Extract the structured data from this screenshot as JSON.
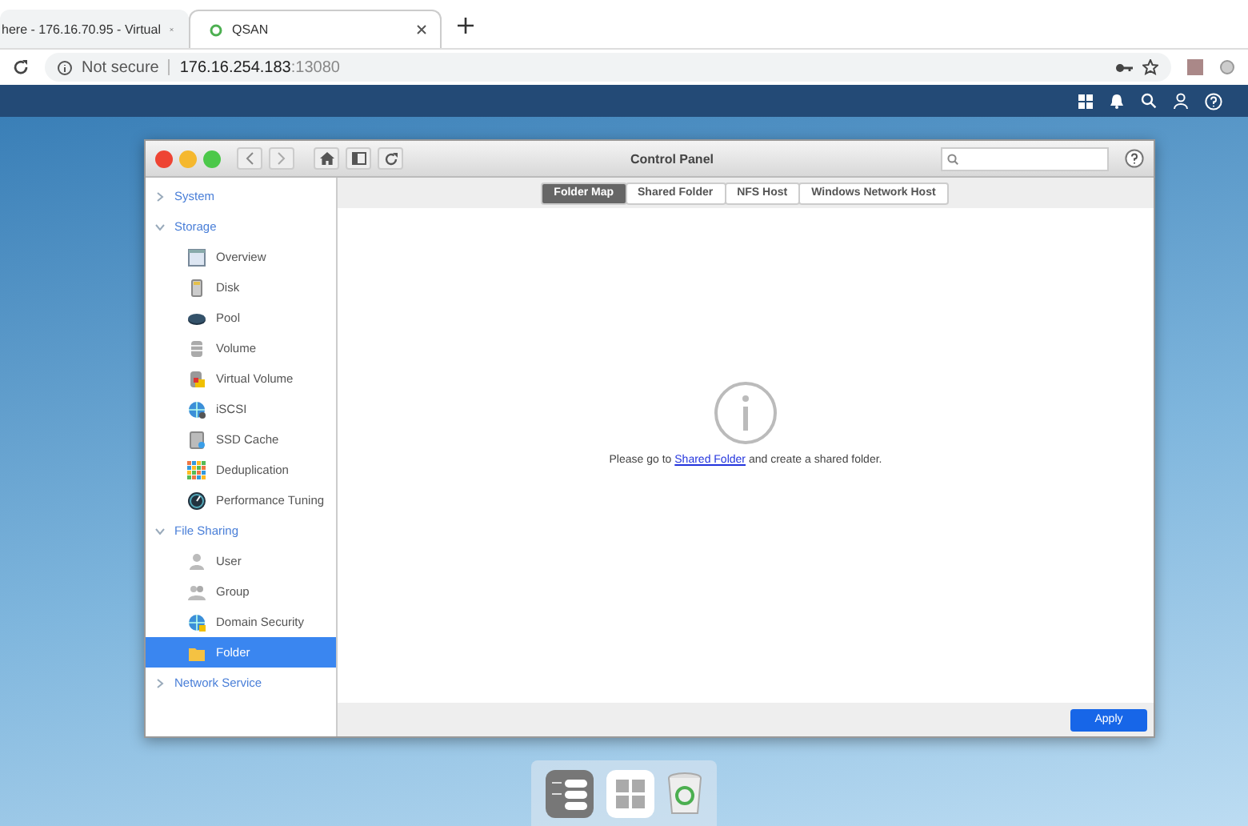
{
  "browser": {
    "tabs": [
      {
        "title": "here - 176.16.70.95 - Virtual",
        "selected": false
      },
      {
        "title": "QSAN",
        "selected": true
      }
    ],
    "security": "Not secure",
    "url_host": "176.16.254.183",
    "url_port": ":13080"
  },
  "window": {
    "title": "Control Panel"
  },
  "sidebar": [
    {
      "label": "System",
      "expanded": false
    },
    {
      "label": "Storage",
      "expanded": true,
      "children": [
        {
          "label": "Overview",
          "selected": false
        },
        {
          "label": "Disk",
          "selected": false
        },
        {
          "label": "Pool",
          "selected": false
        },
        {
          "label": "Volume",
          "selected": false
        },
        {
          "label": "Virtual Volume",
          "selected": false
        },
        {
          "label": "iSCSI",
          "selected": false
        },
        {
          "label": "SSD Cache",
          "selected": false
        },
        {
          "label": "Deduplication",
          "selected": false
        },
        {
          "label": "Performance Tuning",
          "selected": false
        }
      ]
    },
    {
      "label": "File Sharing",
      "expanded": true,
      "children": [
        {
          "label": "User",
          "selected": false
        },
        {
          "label": "Group",
          "selected": false
        },
        {
          "label": "Domain Security",
          "selected": false
        },
        {
          "label": "Folder",
          "selected": true
        }
      ]
    },
    {
      "label": "Network Service",
      "expanded": false
    }
  ],
  "tabs": [
    {
      "label": "Folder Map",
      "selected": true
    },
    {
      "label": "Shared Folder",
      "selected": false
    },
    {
      "label": "NFS Host",
      "selected": false
    },
    {
      "label": "Windows Network Host",
      "selected": false
    }
  ],
  "message": {
    "before": "Please go to",
    "link": "Shared Folder",
    "after": "and create a shared folder."
  },
  "footer": {
    "button": "Apply"
  }
}
